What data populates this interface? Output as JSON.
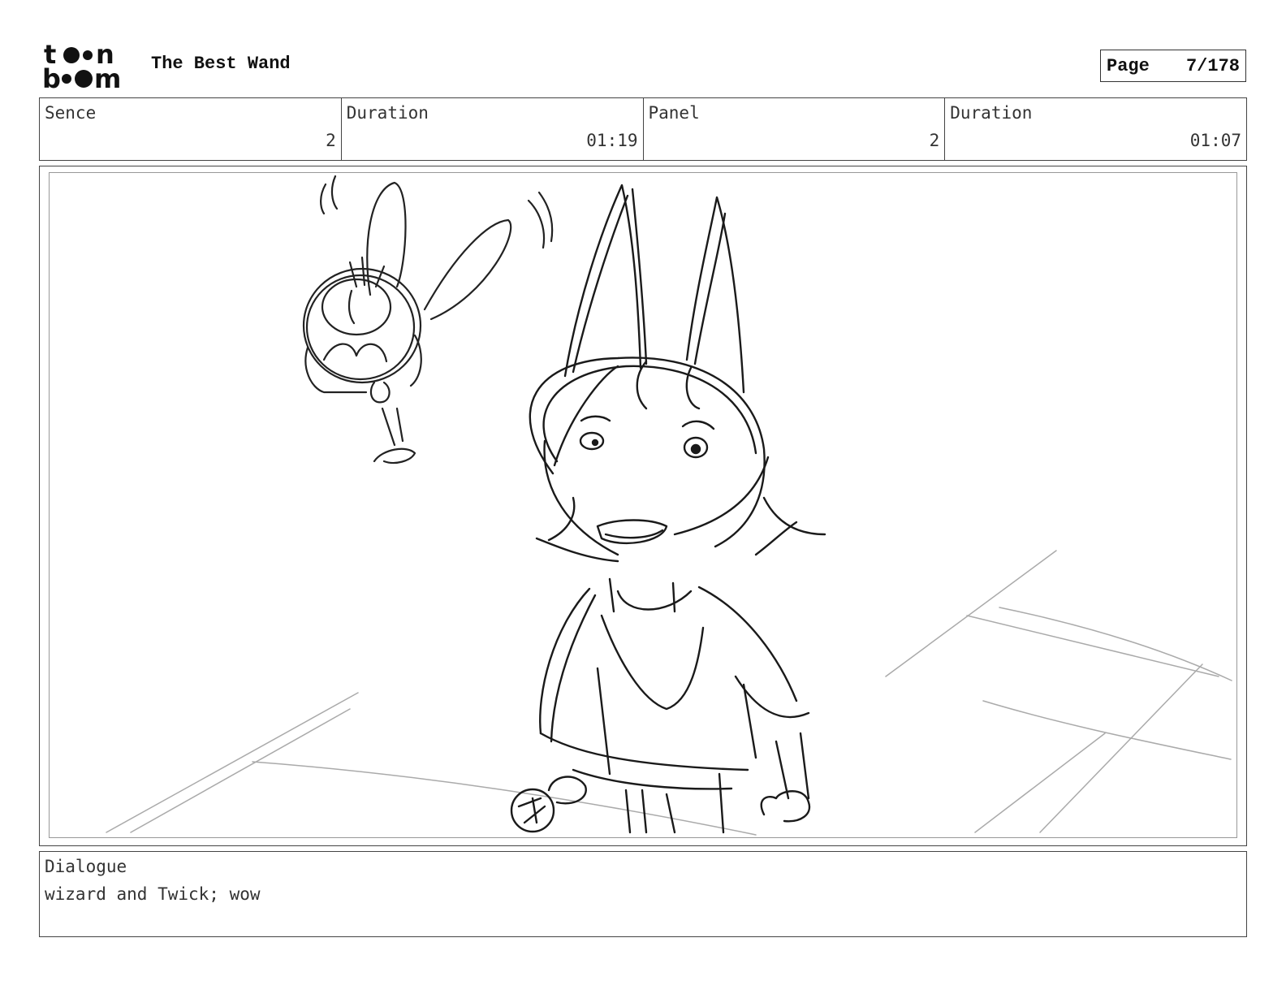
{
  "header": {
    "logo_alt": "toon boom",
    "title": "The Best Wand",
    "page_label": "Page",
    "page_value": "7/178"
  },
  "info": {
    "scene_label": "Sence",
    "scene_value": "2",
    "scene_duration_label": "Duration",
    "scene_duration_value": "01:19",
    "panel_label": "Panel",
    "panel_value": "2",
    "panel_duration_label": "Duration",
    "panel_duration_value": "01:07"
  },
  "dialogue": {
    "label": "Dialogue",
    "text": "wizard and Twick; wow"
  }
}
